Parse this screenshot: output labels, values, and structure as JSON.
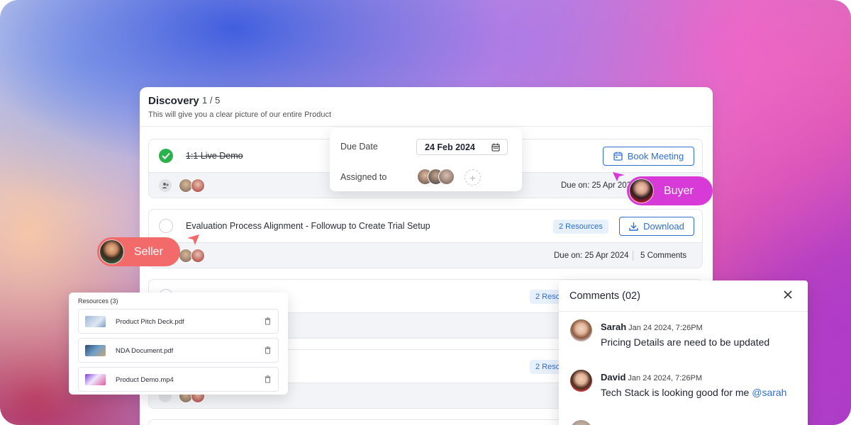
{
  "stage": {
    "title": "Discovery",
    "count": "1 / 5",
    "subtitle": "This will give you a clear picture of our entire Product"
  },
  "tasks": [
    {
      "name": "1:1 Live Demo",
      "completed": true,
      "action_label": "Book Meeting",
      "action_icon": "calendar-icon",
      "due": "Due on: 25 Apr 2024"
    },
    {
      "name": "Evaluation Process Alignment - Followup to Create Trial Setup",
      "completed": false,
      "resources_label": "2 Resources",
      "action_label": "Download",
      "action_icon": "download-icon",
      "due": "Due on: 25 Apr 2024",
      "comments": "5 Comments"
    },
    {
      "resources_label": "2 Reso"
    },
    {
      "resources_label": "2 Reso"
    }
  ],
  "popover": {
    "due_label": "Due Date",
    "due_value": "24 Feb 2024",
    "assigned_label": "Assigned to"
  },
  "badges": {
    "buyer": "Buyer",
    "seller": "Seller",
    "buyer_color": "#d83ad8",
    "seller_color": "#f36a6a"
  },
  "resources": {
    "title": "Resources (3)",
    "items": [
      {
        "name": "Product Pitch Deck.pdf"
      },
      {
        "name": "NDA Document.pdf"
      },
      {
        "name": "Product Demo.mp4"
      }
    ]
  },
  "comments": {
    "title": "Comments (02)",
    "items": [
      {
        "author": "Sarah",
        "time": "Jan 24 2024, 7:26PM",
        "text": "Pricing Details are need to be updated"
      },
      {
        "author": "David",
        "time": "Jan 24 2024, 7:26PM",
        "text": "Tech Stack is looking good for me ",
        "mention": "@sarah"
      }
    ]
  },
  "colors": {
    "accent": "#2f6fd1",
    "success": "#2bb24c"
  }
}
